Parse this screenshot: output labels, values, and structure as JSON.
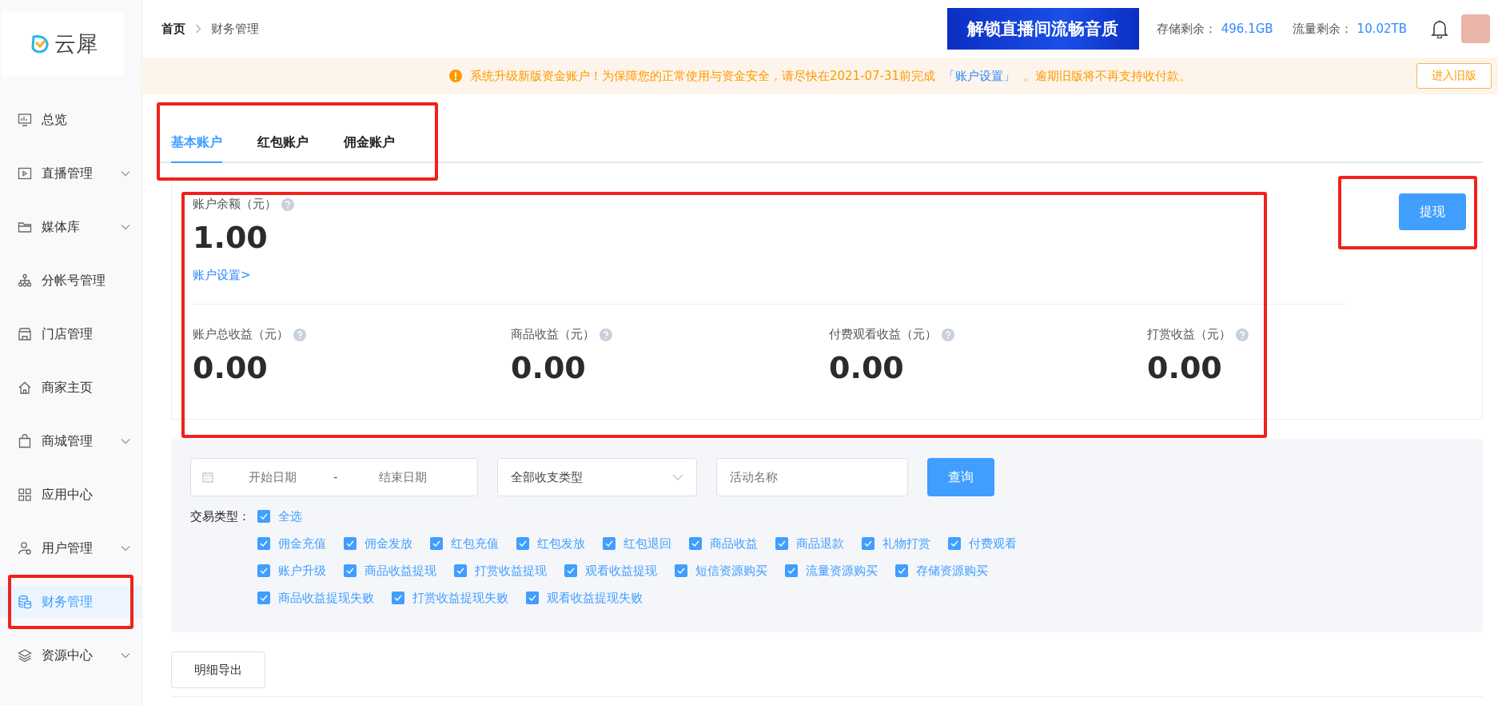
{
  "logo": {
    "text": "云犀"
  },
  "sidebar": {
    "items": [
      {
        "label": "总览",
        "kind": "chart",
        "submenu": false,
        "selected": false
      },
      {
        "label": "直播管理",
        "kind": "play",
        "submenu": true,
        "selected": false
      },
      {
        "label": "媒体库",
        "kind": "folder",
        "submenu": true,
        "selected": false
      },
      {
        "label": "分帐号管理",
        "kind": "tree",
        "submenu": false,
        "selected": false
      },
      {
        "label": "门店管理",
        "kind": "store",
        "submenu": false,
        "selected": false
      },
      {
        "label": "商家主页",
        "kind": "home",
        "submenu": false,
        "selected": false
      },
      {
        "label": "商城管理",
        "kind": "bag",
        "submenu": true,
        "selected": false
      },
      {
        "label": "应用中心",
        "kind": "grid",
        "submenu": false,
        "selected": false
      },
      {
        "label": "用户管理",
        "kind": "user",
        "submenu": true,
        "selected": false
      },
      {
        "label": "财务管理",
        "kind": "coins",
        "submenu": false,
        "selected": true
      },
      {
        "label": "资源中心",
        "kind": "layers",
        "submenu": true,
        "selected": false
      }
    ]
  },
  "breadcrumb": [
    "首页",
    "财务管理"
  ],
  "promo_banner": {
    "text": "解锁直播间流畅音质"
  },
  "quota": [
    {
      "label": "存储剩余：",
      "value": "496.1GB"
    },
    {
      "label": "流量剩余：",
      "value": "10.02TB"
    }
  ],
  "notice": {
    "before": "系统升级新版资金账户！为保障您的正常使用与资金安全，请尽快在2021-07-31前完成",
    "link": "「账户设置」",
    "after": "。逾期旧版将不再支持收付款。",
    "button": "进入旧版"
  },
  "tabs": [
    {
      "label": "基本账户",
      "selected": true
    },
    {
      "label": "红包账户",
      "selected": false
    },
    {
      "label": "佣金账户",
      "selected": false
    }
  ],
  "balance": {
    "label": "账户余额（元）",
    "value": "1.00",
    "link": "账户设置>"
  },
  "withdraw_button": "提现",
  "stats": [
    {
      "label": "账户总收益（元）",
      "value": "0.00"
    },
    {
      "label": "商品收益（元）",
      "value": "0.00"
    },
    {
      "label": "付费观看收益（元）",
      "value": "0.00"
    },
    {
      "label": "打赏收益（元）",
      "value": "0.00"
    }
  ],
  "filters": {
    "start_date": {
      "placeholder": "开始日期"
    },
    "separator": "-",
    "end_date": {
      "placeholder": "结束日期"
    },
    "type_select": {
      "value": "全部收支类型"
    },
    "activity": {
      "placeholder": "活动名称"
    },
    "query_button": "查询"
  },
  "transaction_types": {
    "label": "交易类型：",
    "all": {
      "label": "全选",
      "checked": true
    },
    "lines": [
      {
        "options": [
          {
            "label": "佣金充值",
            "checked": true
          },
          {
            "label": "佣金发放",
            "checked": true
          },
          {
            "label": "红包充值",
            "checked": true
          },
          {
            "label": "红包发放",
            "checked": true
          },
          {
            "label": "红包退回",
            "checked": true
          },
          {
            "label": "商品收益",
            "checked": true
          },
          {
            "label": "商品退款",
            "checked": true
          },
          {
            "label": "礼物打赏",
            "checked": true
          },
          {
            "label": "付费观看",
            "checked": true
          }
        ]
      },
      {
        "options": [
          {
            "label": "账户升级",
            "checked": true
          },
          {
            "label": "商品收益提现",
            "checked": true
          },
          {
            "label": "打赏收益提现",
            "checked": true
          },
          {
            "label": "观看收益提现",
            "checked": true
          },
          {
            "label": "短信资源购买",
            "checked": true
          },
          {
            "label": "流量资源购买",
            "checked": true
          },
          {
            "label": "存储资源购买",
            "checked": true
          }
        ]
      },
      {
        "options": [
          {
            "label": "商品收益提现失败",
            "checked": true
          },
          {
            "label": "打赏收益提现失败",
            "checked": true
          },
          {
            "label": "观看收益提现失败",
            "checked": true
          }
        ]
      }
    ]
  },
  "export_button": "明细导出"
}
